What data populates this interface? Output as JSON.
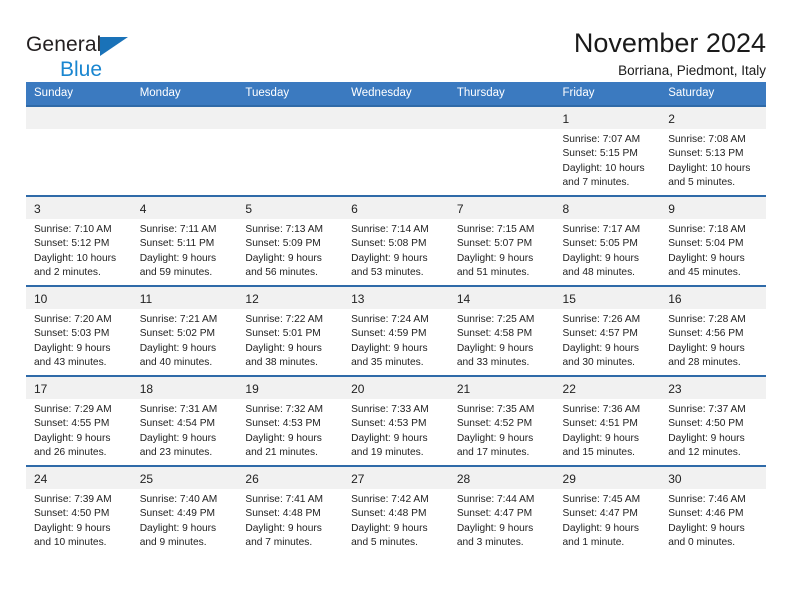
{
  "brand": {
    "name_top": "General",
    "name_bottom": "Blue",
    "triangle_color": "#1a72b8",
    "blue_color": "#1a86d0"
  },
  "header": {
    "title": "November 2024",
    "subtitle": "Borriana, Piedmont, Italy"
  },
  "theme": {
    "header_blue": "#3b7ac0",
    "row_rule_blue": "#2f6aa8",
    "daynum_band": "#f1f1f1"
  },
  "calendar": {
    "weekday_headers": [
      "Sunday",
      "Monday",
      "Tuesday",
      "Wednesday",
      "Thursday",
      "Friday",
      "Saturday"
    ],
    "weeks": [
      [
        {
          "day": "",
          "lines": []
        },
        {
          "day": "",
          "lines": []
        },
        {
          "day": "",
          "lines": []
        },
        {
          "day": "",
          "lines": []
        },
        {
          "day": "",
          "lines": []
        },
        {
          "day": "1",
          "lines": [
            "Sunrise: 7:07 AM",
            "Sunset: 5:15 PM",
            "Daylight: 10 hours",
            "and 7 minutes."
          ]
        },
        {
          "day": "2",
          "lines": [
            "Sunrise: 7:08 AM",
            "Sunset: 5:13 PM",
            "Daylight: 10 hours",
            "and 5 minutes."
          ]
        }
      ],
      [
        {
          "day": "3",
          "lines": [
            "Sunrise: 7:10 AM",
            "Sunset: 5:12 PM",
            "Daylight: 10 hours",
            "and 2 minutes."
          ]
        },
        {
          "day": "4",
          "lines": [
            "Sunrise: 7:11 AM",
            "Sunset: 5:11 PM",
            "Daylight: 9 hours",
            "and 59 minutes."
          ]
        },
        {
          "day": "5",
          "lines": [
            "Sunrise: 7:13 AM",
            "Sunset: 5:09 PM",
            "Daylight: 9 hours",
            "and 56 minutes."
          ]
        },
        {
          "day": "6",
          "lines": [
            "Sunrise: 7:14 AM",
            "Sunset: 5:08 PM",
            "Daylight: 9 hours",
            "and 53 minutes."
          ]
        },
        {
          "day": "7",
          "lines": [
            "Sunrise: 7:15 AM",
            "Sunset: 5:07 PM",
            "Daylight: 9 hours",
            "and 51 minutes."
          ]
        },
        {
          "day": "8",
          "lines": [
            "Sunrise: 7:17 AM",
            "Sunset: 5:05 PM",
            "Daylight: 9 hours",
            "and 48 minutes."
          ]
        },
        {
          "day": "9",
          "lines": [
            "Sunrise: 7:18 AM",
            "Sunset: 5:04 PM",
            "Daylight: 9 hours",
            "and 45 minutes."
          ]
        }
      ],
      [
        {
          "day": "10",
          "lines": [
            "Sunrise: 7:20 AM",
            "Sunset: 5:03 PM",
            "Daylight: 9 hours",
            "and 43 minutes."
          ]
        },
        {
          "day": "11",
          "lines": [
            "Sunrise: 7:21 AM",
            "Sunset: 5:02 PM",
            "Daylight: 9 hours",
            "and 40 minutes."
          ]
        },
        {
          "day": "12",
          "lines": [
            "Sunrise: 7:22 AM",
            "Sunset: 5:01 PM",
            "Daylight: 9 hours",
            "and 38 minutes."
          ]
        },
        {
          "day": "13",
          "lines": [
            "Sunrise: 7:24 AM",
            "Sunset: 4:59 PM",
            "Daylight: 9 hours",
            "and 35 minutes."
          ]
        },
        {
          "day": "14",
          "lines": [
            "Sunrise: 7:25 AM",
            "Sunset: 4:58 PM",
            "Daylight: 9 hours",
            "and 33 minutes."
          ]
        },
        {
          "day": "15",
          "lines": [
            "Sunrise: 7:26 AM",
            "Sunset: 4:57 PM",
            "Daylight: 9 hours",
            "and 30 minutes."
          ]
        },
        {
          "day": "16",
          "lines": [
            "Sunrise: 7:28 AM",
            "Sunset: 4:56 PM",
            "Daylight: 9 hours",
            "and 28 minutes."
          ]
        }
      ],
      [
        {
          "day": "17",
          "lines": [
            "Sunrise: 7:29 AM",
            "Sunset: 4:55 PM",
            "Daylight: 9 hours",
            "and 26 minutes."
          ]
        },
        {
          "day": "18",
          "lines": [
            "Sunrise: 7:31 AM",
            "Sunset: 4:54 PM",
            "Daylight: 9 hours",
            "and 23 minutes."
          ]
        },
        {
          "day": "19",
          "lines": [
            "Sunrise: 7:32 AM",
            "Sunset: 4:53 PM",
            "Daylight: 9 hours",
            "and 21 minutes."
          ]
        },
        {
          "day": "20",
          "lines": [
            "Sunrise: 7:33 AM",
            "Sunset: 4:53 PM",
            "Daylight: 9 hours",
            "and 19 minutes."
          ]
        },
        {
          "day": "21",
          "lines": [
            "Sunrise: 7:35 AM",
            "Sunset: 4:52 PM",
            "Daylight: 9 hours",
            "and 17 minutes."
          ]
        },
        {
          "day": "22",
          "lines": [
            "Sunrise: 7:36 AM",
            "Sunset: 4:51 PM",
            "Daylight: 9 hours",
            "and 15 minutes."
          ]
        },
        {
          "day": "23",
          "lines": [
            "Sunrise: 7:37 AM",
            "Sunset: 4:50 PM",
            "Daylight: 9 hours",
            "and 12 minutes."
          ]
        }
      ],
      [
        {
          "day": "24",
          "lines": [
            "Sunrise: 7:39 AM",
            "Sunset: 4:50 PM",
            "Daylight: 9 hours",
            "and 10 minutes."
          ]
        },
        {
          "day": "25",
          "lines": [
            "Sunrise: 7:40 AM",
            "Sunset: 4:49 PM",
            "Daylight: 9 hours",
            "and 9 minutes."
          ]
        },
        {
          "day": "26",
          "lines": [
            "Sunrise: 7:41 AM",
            "Sunset: 4:48 PM",
            "Daylight: 9 hours",
            "and 7 minutes."
          ]
        },
        {
          "day": "27",
          "lines": [
            "Sunrise: 7:42 AM",
            "Sunset: 4:48 PM",
            "Daylight: 9 hours",
            "and 5 minutes."
          ]
        },
        {
          "day": "28",
          "lines": [
            "Sunrise: 7:44 AM",
            "Sunset: 4:47 PM",
            "Daylight: 9 hours",
            "and 3 minutes."
          ]
        },
        {
          "day": "29",
          "lines": [
            "Sunrise: 7:45 AM",
            "Sunset: 4:47 PM",
            "Daylight: 9 hours",
            "and 1 minute."
          ]
        },
        {
          "day": "30",
          "lines": [
            "Sunrise: 7:46 AM",
            "Sunset: 4:46 PM",
            "Daylight: 9 hours",
            "and 0 minutes."
          ]
        }
      ]
    ]
  }
}
